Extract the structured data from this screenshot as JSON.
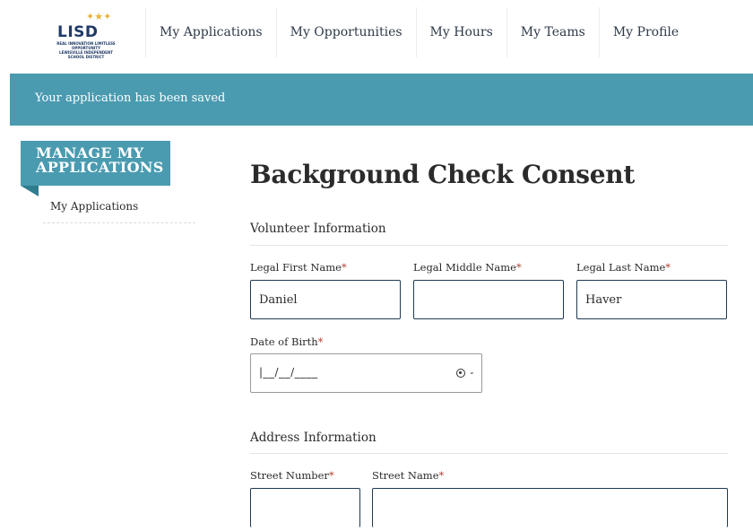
{
  "logo": {
    "text": "LISD",
    "tagline": "REAL INNOVATION LIMITLESS OPPORTUNITY",
    "district": "LEWISVILLE INDEPENDENT SCHOOL DISTRICT",
    "star_color": "#e9b53a",
    "brand_color": "#1f3a66"
  },
  "nav": [
    "My Applications",
    "My Opportunities",
    "My Hours",
    "My Teams",
    "My Profile"
  ],
  "banner": {
    "text": "Your application has been saved",
    "color": "#4a9bb0"
  },
  "sidebar": {
    "heading_line1": "MANAGE MY",
    "heading_line2": "APPLICATIONS",
    "items": [
      "My Applications"
    ]
  },
  "page": {
    "title": "Background Check Consent"
  },
  "volunteer": {
    "heading": "Volunteer Information",
    "first_name_label": "Legal First Name",
    "middle_name_label": "Legal Middle Name",
    "last_name_label": "Legal Last Name",
    "first_name_value": "Daniel",
    "middle_name_value": "",
    "last_name_value": "Haver",
    "dob_label": "Date of Birth",
    "dob_mask": "|__/__/____"
  },
  "address": {
    "heading": "Address Information",
    "street_number_label": "Street Number",
    "street_name_label": "Street Name",
    "street_number_value": "",
    "street_name_value": ""
  },
  "required_marker": "*",
  "icons": {
    "date": "calendar-picker-icon",
    "chevron": "chevron-down-icon"
  }
}
